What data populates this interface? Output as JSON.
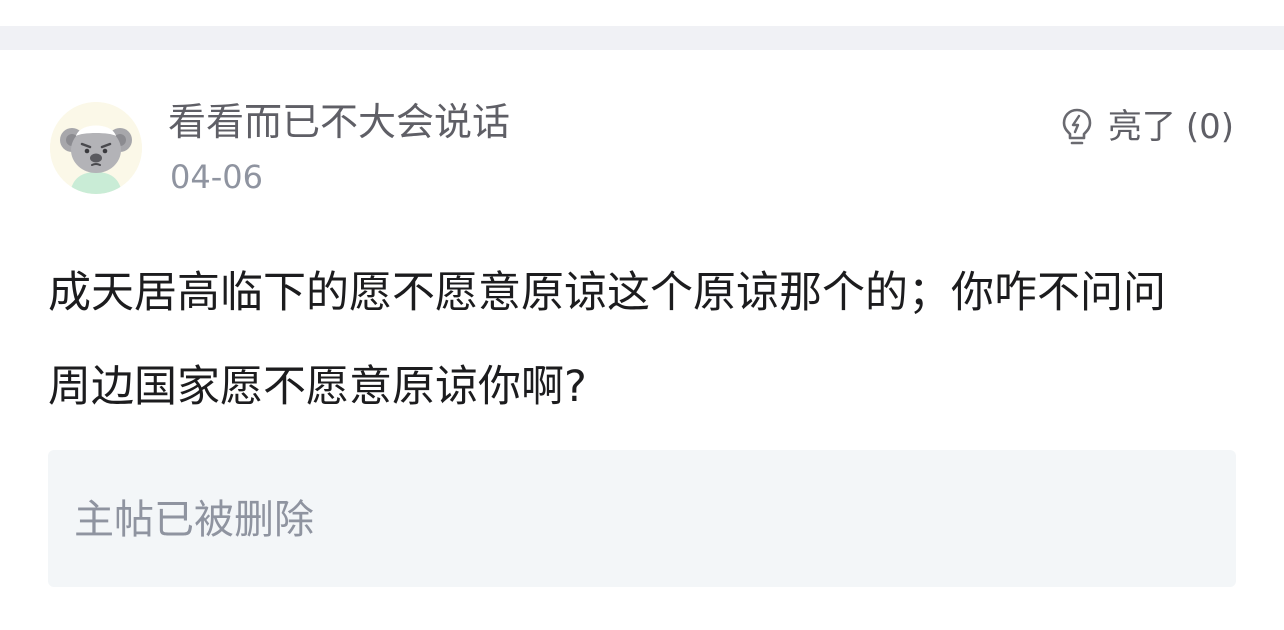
{
  "comment": {
    "user_name": "看看而已不大会说话",
    "date": "04-06",
    "like": {
      "label": "亮了",
      "count": "(0)",
      "icon": "lightbulb-icon"
    },
    "text": "成天居高临下的愿不愿意原谅这个原谅那个的；你咋不问问周边国家愿不愿意原谅你啊?",
    "quoted_post": "主帖已被删除",
    "avatar": "koala-avatar"
  },
  "colors": {
    "divider_band": "#f0f1f5",
    "quote_background": "#f3f6f8",
    "primary_text": "#1c1c1e",
    "secondary_text": "#8f94a0"
  }
}
